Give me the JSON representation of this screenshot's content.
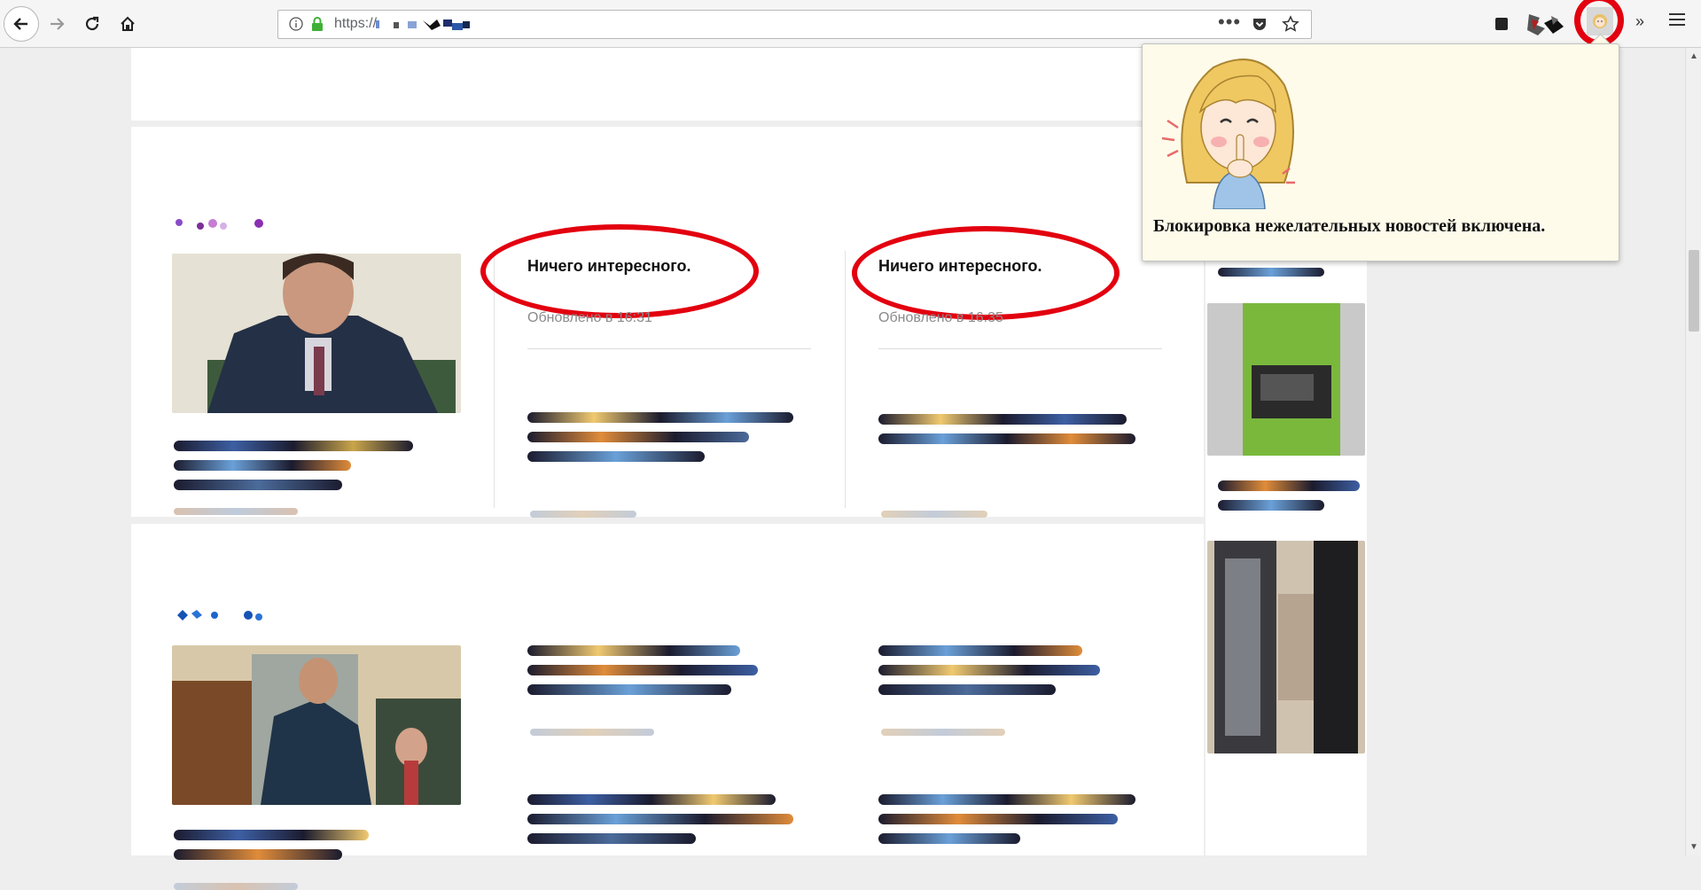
{
  "browser": {
    "url_prefix": "https://",
    "more_label": "•••",
    "overflow_label": "»"
  },
  "news": {
    "column_1": {
      "heading": "Ничего интересного.",
      "updated": "Обновлено в 16:31"
    },
    "column_2": {
      "heading": "Ничего интересного.",
      "updated": "Обновлено в 16:35"
    }
  },
  "popup": {
    "message": "Блокировка нежелательных новостей включена."
  },
  "colors": {
    "highlight_red": "#e3000f",
    "popup_bg": "#fffbea",
    "lock_green": "#3fb035"
  },
  "icons": {
    "toolbar": [
      "back-arrow-icon",
      "forward-arrow-icon",
      "reload-icon",
      "home-icon",
      "info-icon",
      "lock-icon",
      "pocket-icon",
      "star-icon",
      "menu-icon"
    ],
    "extension": "girl-shush-extension-icon"
  }
}
